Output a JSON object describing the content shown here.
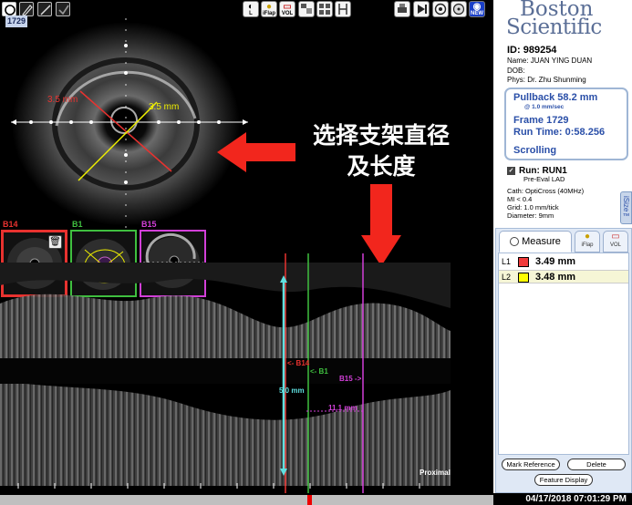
{
  "toolbar_left": {
    "icons": [
      "circle-icon",
      "pen-icon",
      "slash-icon",
      "checkbox-icon"
    ]
  },
  "toolbar_center": {
    "buttons": [
      {
        "name": "lumen-button",
        "label": "L"
      },
      {
        "name": "iflap-button",
        "label": "iFlap"
      },
      {
        "name": "vol-button",
        "label": "VOL"
      },
      {
        "name": "layout-button",
        "label": ""
      },
      {
        "name": "grid-button",
        "label": ""
      },
      {
        "name": "measure-tool-button",
        "label": ""
      }
    ]
  },
  "toolbar_right": {
    "buttons": [
      {
        "name": "print-button",
        "label": ""
      },
      {
        "name": "play-button",
        "label": ""
      },
      {
        "name": "record-button",
        "label": ""
      },
      {
        "name": "export-button",
        "label": ""
      },
      {
        "name": "new-button",
        "label": "NEW"
      }
    ]
  },
  "frame_badge": "1729",
  "ivus_image": {
    "measure_red": "3.5 mm",
    "measure_yellow": "3.5 mm"
  },
  "annotation": {
    "line1": "选择支架直径",
    "line2": "及长度"
  },
  "bookmarks": [
    {
      "label": "B14",
      "color": "#e8322f"
    },
    {
      "label": "B1",
      "color": "#3fbf3f"
    },
    {
      "label": "B15",
      "color": "#d23fd8"
    }
  ],
  "longview": {
    "marker_b14": "<- B14",
    "marker_b1": "<- B1",
    "marker_b15": "B15 ->",
    "length_cyan": "5.0 mm",
    "length_magenta": "11.1 mm",
    "proximal": "Proximal"
  },
  "brand": {
    "line1": "Boston",
    "line2": "Scientific"
  },
  "patient": {
    "id": "ID: 989254",
    "name": "Name:  JUAN YING DUAN",
    "dob": "DOB:",
    "phys": "Phys:   Dr. Zhu Shunming"
  },
  "pullback": {
    "title": "Pullback 58.2 mm",
    "rate": "@ 1.0 mm/sec",
    "frame": "Frame 1729",
    "run_time": "Run Time: 0:58.256",
    "mode": "Scrolling"
  },
  "run": {
    "title": "Run: RUN1",
    "desc": "Pre-Eval LAD",
    "cath": "Cath: OptiCross (40MHz)",
    "mi": "MI <   0.4",
    "grid": "Grid:    1.0 mm/tick",
    "diameter": "Diameter:   9mm"
  },
  "isize_tab": "iSize™",
  "measure_panel": {
    "tab_measure": "Measure",
    "tab_iflap": "iFlap",
    "tab_vol": "VOL",
    "rows": [
      {
        "label": "L1",
        "color": "#f03a3a",
        "value": "3.49 mm"
      },
      {
        "label": "L2",
        "color": "#ffff00",
        "value": "3.48 mm"
      }
    ],
    "btn_mark_reference": "Mark Reference",
    "btn_delete": "Delete",
    "btn_feature_display": "Feature Display"
  },
  "status": {
    "datetime": "04/17/2018 07:01:29 PM"
  }
}
